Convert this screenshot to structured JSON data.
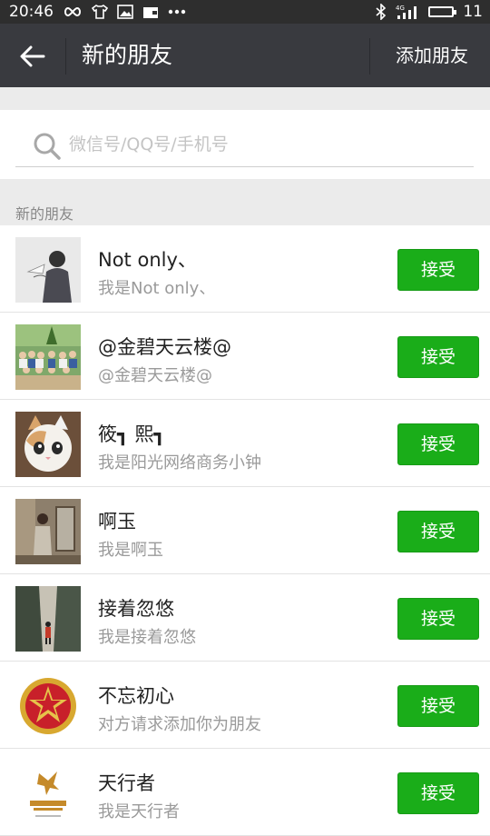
{
  "status_bar": {
    "time": "20:46",
    "signal_label": "4G",
    "battery_level": "11"
  },
  "header": {
    "title": "新的朋友",
    "action_label": "添加朋友"
  },
  "search": {
    "placeholder": "微信号/QQ号/手机号"
  },
  "section": {
    "label": "新的朋友"
  },
  "requests": [
    {
      "name": "Not only、",
      "message": "我是Not only、",
      "button": "接受",
      "avatar": "sketch-person-avatar"
    },
    {
      "name": "@金碧天云楼@",
      "message": "@金碧天云楼@",
      "button": "接受",
      "avatar": "group-photo-avatar"
    },
    {
      "name": "筱┓ 熙┓",
      "message": "我是阳光网络商务小钟",
      "button": "接受",
      "avatar": "cat-avatar"
    },
    {
      "name": "啊玉",
      "message": "我是啊玉",
      "button": "接受",
      "avatar": "room-photo-avatar"
    },
    {
      "name": "接着忽悠",
      "message": "我是接着忽悠",
      "button": "接受",
      "avatar": "alley-photo-avatar"
    },
    {
      "name": "不忘初心",
      "message": "对方请求添加你为朋友",
      "button": "接受",
      "avatar": "red-star-emblem-avatar"
    },
    {
      "name": "天行者",
      "message": "我是天行者",
      "button": "接受",
      "avatar": "skywalker-logo-avatar"
    }
  ],
  "colors": {
    "accept_green": "#1aad19",
    "appbar": "#393a3f",
    "statusbar": "#2e2e2e"
  }
}
